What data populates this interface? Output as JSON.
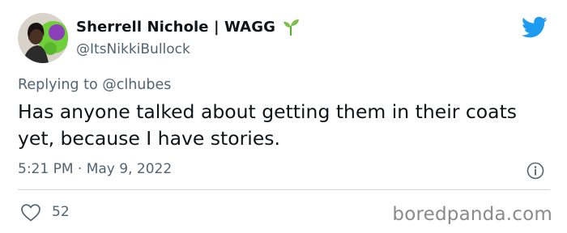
{
  "author": {
    "display_name": "Sherrell Nichole | WAGG",
    "handle": "@ItsNikkiBullock",
    "name_emoji": "seedling-icon"
  },
  "platform_icon": "twitter-bird-icon",
  "reply": {
    "prefix": "Replying to ",
    "mention": "@clhubes"
  },
  "tweet": {
    "text": "Has anyone talked about getting them in their coats yet, because I have stories.",
    "timestamp": "5:21 PM · May 9, 2022"
  },
  "actions": {
    "like_icon": "heart-icon",
    "like_count": "52",
    "info_icon": "info-icon"
  },
  "watermark": "boredpanda.com",
  "colors": {
    "text": "#0f1419",
    "secondary": "#536471",
    "twitter_blue": "#1d9bf0",
    "divider": "#cfd9de",
    "watermark": "#8a8a8a"
  }
}
